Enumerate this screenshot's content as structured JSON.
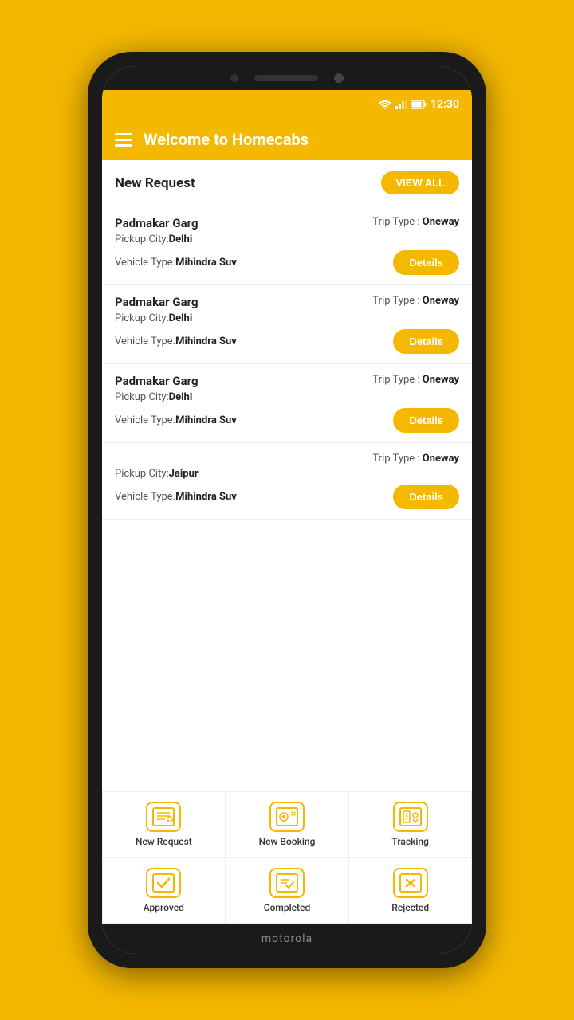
{
  "app": {
    "title": "Welcome to Homecabs",
    "status_time": "12:30"
  },
  "header": {
    "title": "Welcome to Homecabs"
  },
  "new_request_section": {
    "title": "New Request",
    "view_all_label": "VIEW ALL"
  },
  "rides": [
    {
      "name": "Padmakar Garg",
      "trip_type": "Oneway",
      "pickup_city": "Delhi",
      "vehicle_type": "Mihindra Suv",
      "details_label": "Details"
    },
    {
      "name": "Padmakar Garg",
      "trip_type": "Oneway",
      "pickup_city": "Delhi",
      "vehicle_type": "Mihindra Suv",
      "details_label": "Details"
    },
    {
      "name": "Padmakar Garg",
      "trip_type": "Oneway",
      "pickup_city": "Delhi",
      "vehicle_type": "Mihindra Suv",
      "details_label": "Details"
    },
    {
      "name": "",
      "trip_type": "Oneway",
      "pickup_city": "Jaipur",
      "vehicle_type": "Mihindra Suv",
      "details_label": "Details"
    }
  ],
  "nav_items": [
    {
      "label": "New Request",
      "icon": "new-request-icon"
    },
    {
      "label": "New Booking",
      "icon": "new-booking-icon"
    },
    {
      "label": "Tracking",
      "icon": "tracking-icon"
    },
    {
      "label": "Approved",
      "icon": "approved-icon"
    },
    {
      "label": "Completed",
      "icon": "completed-icon"
    },
    {
      "label": "Rejected",
      "icon": "rejected-icon"
    }
  ],
  "brand": "motorola"
}
